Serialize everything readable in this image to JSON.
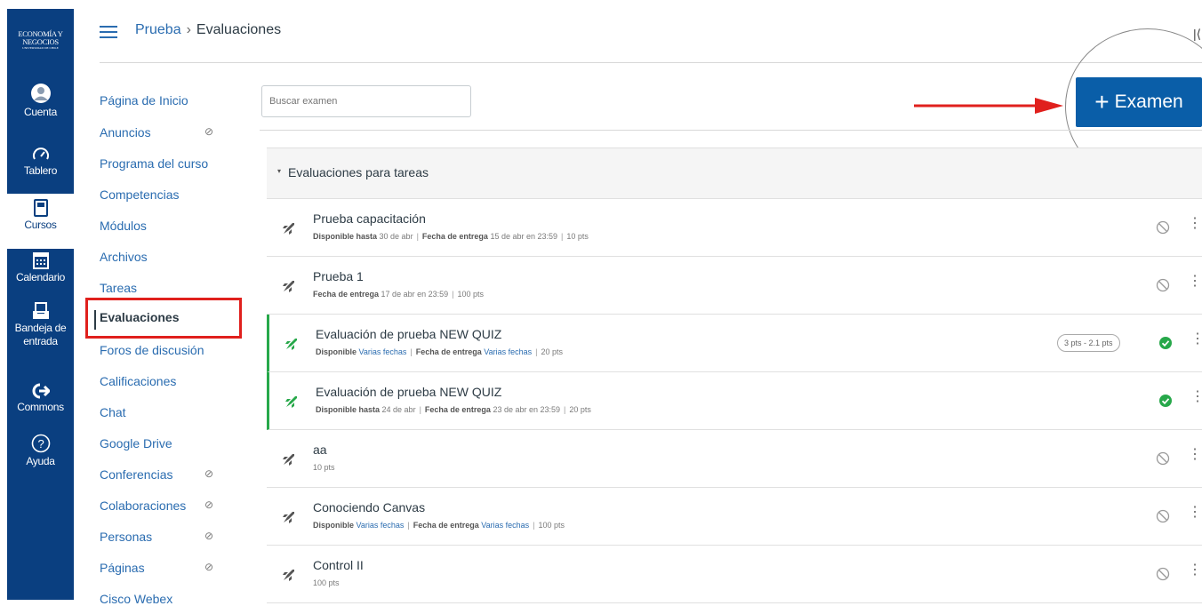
{
  "global_nav": {
    "logo": {
      "line1": "ECONOMÍA Y",
      "line2": "NEGOCIOS",
      "line3": "UNIVERSIDAD DE CHILE"
    },
    "items": [
      {
        "label": "Cuenta",
        "icon": "account-icon"
      },
      {
        "label": "Tablero",
        "icon": "dashboard-icon"
      },
      {
        "label": "Cursos",
        "icon": "courses-icon"
      },
      {
        "label": "Calendario",
        "icon": "calendar-icon"
      },
      {
        "label": "Bandeja de entrada",
        "icon": "inbox-icon"
      },
      {
        "label": "Commons",
        "icon": "commons-icon"
      },
      {
        "label": "Ayuda",
        "icon": "help-icon"
      }
    ]
  },
  "breadcrumb": {
    "course": "Prueba",
    "separator": "›",
    "current": "Evaluaciones"
  },
  "course_nav": {
    "items": [
      {
        "label": "Página de Inicio"
      },
      {
        "label": "Anuncios"
      },
      {
        "label": "Programa del curso"
      },
      {
        "label": "Competencias"
      },
      {
        "label": "Módulos"
      },
      {
        "label": "Archivos"
      },
      {
        "label": "Tareas"
      },
      {
        "label": "Evaluaciones"
      },
      {
        "label": "Foros de discusión"
      },
      {
        "label": "Calificaciones"
      },
      {
        "label": "Chat"
      },
      {
        "label": "Google Drive"
      },
      {
        "label": "Conferencias"
      },
      {
        "label": "Colaboraciones"
      },
      {
        "label": "Personas"
      },
      {
        "label": "Páginas"
      },
      {
        "label": "Cisco Webex"
      }
    ]
  },
  "search": {
    "placeholder": "Buscar examen"
  },
  "add_button": {
    "plus": "+",
    "label": "Examen"
  },
  "group": {
    "title": "Evaluaciones para tareas"
  },
  "quizzes": [
    {
      "title": "Prueba capacitación",
      "meta": {
        "available_label": "Disponible hasta",
        "available_value": "30 de abr",
        "due_label": "Fecha de entrega",
        "due_value": "15 de abr en 23:59",
        "points": "10 pts"
      }
    },
    {
      "title": "Prueba 1",
      "meta": {
        "due_label": "Fecha de entrega",
        "due_value": "17 de abr en 23:59",
        "points": "100 pts"
      }
    },
    {
      "title": "Evaluación de prueba NEW QUIZ",
      "badge": "3 pts - 2.1 pts",
      "meta": {
        "available_label": "Disponible",
        "available_value": "Varias fechas",
        "due_label": "Fecha de entrega",
        "due_value": "Varias fechas",
        "points": "20 pts"
      }
    },
    {
      "title": "Evaluación de prueba NEW QUIZ",
      "meta": {
        "available_label": "Disponible hasta",
        "available_value": "24 de abr",
        "due_label": "Fecha de entrega",
        "due_value": "23 de abr en 23:59",
        "points": "20 pts"
      }
    },
    {
      "title": "aa",
      "meta": {
        "points": "10 pts"
      }
    },
    {
      "title": "Conociendo Canvas",
      "meta": {
        "available_label": "Disponible",
        "available_value": "Varias fechas",
        "due_label": "Fecha de entrega",
        "due_value": "Varias fechas",
        "points": "100 pts"
      }
    },
    {
      "title": "Control II",
      "meta": {
        "points": "100 pts"
      }
    }
  ],
  "colors": {
    "nav_bg": "#0a3f80",
    "link": "#2a6cb0",
    "published": "#27a84a",
    "annotation_red": "#e0201d",
    "button": "#0a5ea8"
  },
  "ui_glyphs": {
    "eye_slash": "⊘",
    "kebab": "⋮",
    "caret": "▾",
    "top_right": "|⟨"
  }
}
